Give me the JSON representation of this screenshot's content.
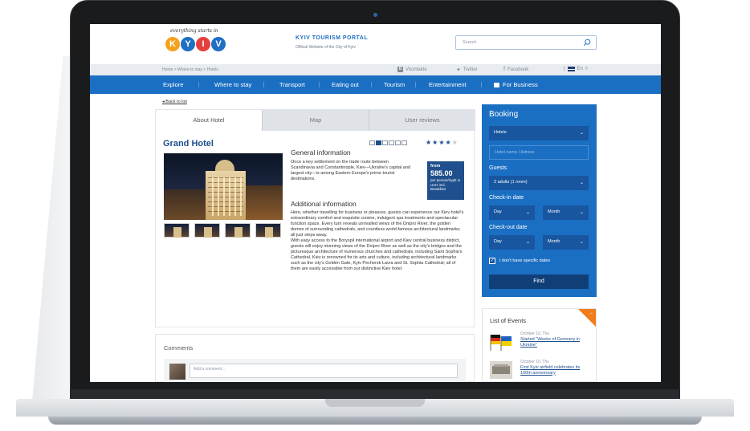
{
  "header": {
    "logo_tagline": "everything starts in",
    "logo_letters": [
      "K",
      "Y",
      "I",
      "V"
    ],
    "logo_colors": [
      "#f4a21c",
      "#1f6fc4",
      "#e53e3e",
      "#1f6fc4"
    ],
    "portal_title": "KYIV TOURISM PORTAL",
    "portal_subtitle": "Official Website of the City of Kyiv",
    "search_placeholder": "Search"
  },
  "breadcrumb": "Home > Where to stay > Hotels",
  "social": {
    "vkontakte": "Vkontakte",
    "twitter": "Twitter",
    "facebook": "Facebook",
    "language": "En"
  },
  "nav": {
    "items": [
      "Explore",
      "Where to stay",
      "Transport",
      "Eating out",
      "Tourism",
      "Entertainment",
      "For Business"
    ]
  },
  "back_link": "Back to list",
  "tabs": [
    "About Hotel",
    "Map",
    "User reviews"
  ],
  "hotel": {
    "name": "Grand Hotel",
    "rating": 4,
    "max_rating": 5,
    "general_title": "General information",
    "general_text": "Once a key settlement on the trade route between Scandinavia and Constantinople, Kiev—Ukraine's capital and largest city—is among Eastern Europe's prime tourist destinations.",
    "price_from": "from",
    "price_amount": "585.00",
    "price_note": "per person/night in UAH incl. Breakfast",
    "additional_title": "Additional information",
    "additional_text": "Here, whether travelling for business or pleasure, guests can experience our Kiev hotel's extraordinary comfort and exquisite cuisine, indulgent spa treatments and spectacular function space. Every turn reveals unrivalled views of the Dnipro River, the golden domes of surrounding cathedrals, and countless world-famous architectural landmarks; all just steps away.",
    "additional_text_2": "With easy access to the Boryspil international airport and Kiev central business district, guests will enjoy stunning views of the Dnipro River as well as the city's bridges and the picturesque architecture of numerous churches and cathedrals, including Saint Sophia's Cathedral. Kiev is renowned for its arts and culture, including architectural landmarks such as the city's Golden Gate, Kyiv Pechersk Lavra and St. Sophia Cathedral; all of them are easily accessible from our distinctive Kiev hotel."
  },
  "comments": {
    "title": "Comments",
    "placeholder": "Add a comment..."
  },
  "booking": {
    "title": "Booking",
    "type_value": "Hotels",
    "name_placeholder": "Hotel name / Adress",
    "guests_label": "Guests",
    "guests_value": "2 adults (1 room)",
    "checkin_label": "Check-in date",
    "checkout_label": "Check-out date",
    "day": "Day",
    "month": "Month",
    "no_dates": "I don't have specific dates",
    "no_dates_checked": true,
    "find": "Find"
  },
  "events": {
    "title": "List of Events",
    "items": [
      {
        "date": "October 10, Thu",
        "title": "Started \"Weeks of Germany in Ukraine\""
      },
      {
        "date": "October 10, Thu",
        "title": "First Kyiv airfield celebrates its 100th anniversary"
      }
    ]
  }
}
